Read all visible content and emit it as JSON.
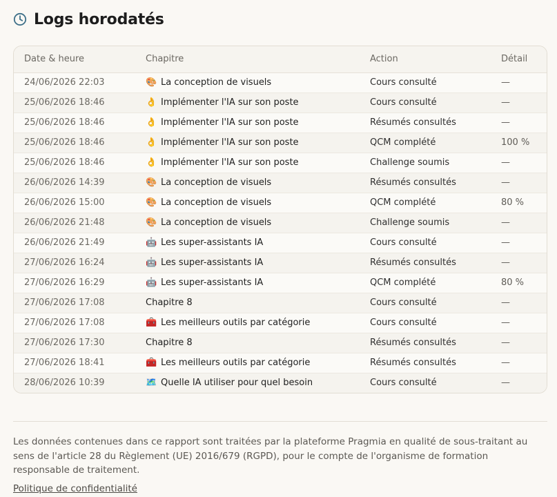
{
  "header": {
    "title": "Logs horodatés",
    "icon": "clock-icon"
  },
  "table": {
    "columns": [
      "Date & heure",
      "Chapitre",
      "Action",
      "Détail"
    ],
    "rows": [
      {
        "date": "24/06/2026 22:03",
        "icon": "🎨",
        "chapter": "La conception de visuels",
        "action": "Cours consulté",
        "detail": "—"
      },
      {
        "date": "25/06/2026 18:46",
        "icon": "👌",
        "chapter": "Implémenter l'IA sur son poste",
        "action": "Cours consulté",
        "detail": "—"
      },
      {
        "date": "25/06/2026 18:46",
        "icon": "👌",
        "chapter": "Implémenter l'IA sur son poste",
        "action": "Résumés consultés",
        "detail": "—"
      },
      {
        "date": "25/06/2026 18:46",
        "icon": "👌",
        "chapter": "Implémenter l'IA sur son poste",
        "action": "QCM complété",
        "detail": "100 %"
      },
      {
        "date": "25/06/2026 18:46",
        "icon": "👌",
        "chapter": "Implémenter l'IA sur son poste",
        "action": "Challenge soumis",
        "detail": "—"
      },
      {
        "date": "26/06/2026 14:39",
        "icon": "🎨",
        "chapter": "La conception de visuels",
        "action": "Résumés consultés",
        "detail": "—"
      },
      {
        "date": "26/06/2026 15:00",
        "icon": "🎨",
        "chapter": "La conception de visuels",
        "action": "QCM complété",
        "detail": "80 %"
      },
      {
        "date": "26/06/2026 21:48",
        "icon": "🎨",
        "chapter": "La conception de visuels",
        "action": "Challenge soumis",
        "detail": "—"
      },
      {
        "date": "26/06/2026 21:49",
        "icon": "🤖",
        "chapter": "Les super-assistants IA",
        "action": "Cours consulté",
        "detail": "—"
      },
      {
        "date": "27/06/2026 16:24",
        "icon": "🤖",
        "chapter": "Les super-assistants IA",
        "action": "Résumés consultés",
        "detail": "—"
      },
      {
        "date": "27/06/2026 16:29",
        "icon": "🤖",
        "chapter": "Les super-assistants IA",
        "action": "QCM complété",
        "detail": "80 %"
      },
      {
        "date": "27/06/2026 17:08",
        "icon": "",
        "chapter": "Chapitre 8",
        "action": "Cours consulté",
        "detail": "—"
      },
      {
        "date": "27/06/2026 17:08",
        "icon": "🧰",
        "chapter": "Les meilleurs outils par catégorie",
        "action": "Cours consulté",
        "detail": "—"
      },
      {
        "date": "27/06/2026 17:30",
        "icon": "",
        "chapter": "Chapitre 8",
        "action": "Résumés consultés",
        "detail": "—"
      },
      {
        "date": "27/06/2026 18:41",
        "icon": "🧰",
        "chapter": "Les meilleurs outils par catégorie",
        "action": "Résumés consultés",
        "detail": "—"
      },
      {
        "date": "28/06/2026 10:39",
        "icon": "🗺️",
        "chapter": "Quelle IA utiliser pour quel besoin",
        "action": "Cours consulté",
        "detail": "—"
      }
    ]
  },
  "footer": {
    "notice": "Les données contenues dans ce rapport sont traitées par la plateforme Pragmia en qualité de sous-traitant au sens de l'article 28 du Règlement (UE) 2016/679 (RGPD), pour le compte de l'organisme de formation responsable de traitement.",
    "privacy_link": "Politique de confidentialité"
  },
  "colors": {
    "accent_icon": "#3d6f88",
    "background": "#faf8f4"
  }
}
